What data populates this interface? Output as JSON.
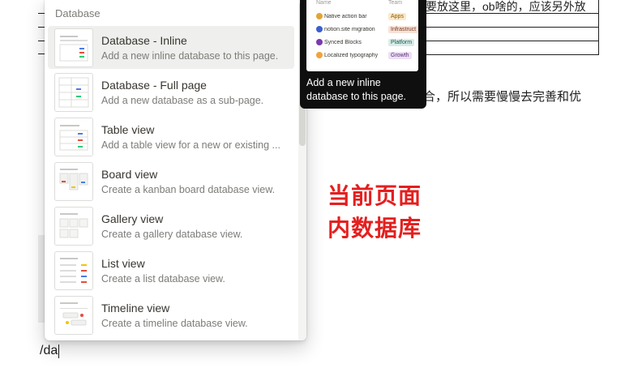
{
  "menu": {
    "section_label": "Database",
    "items": [
      {
        "title": "Database - Inline",
        "description": "Add a new inline database to this page."
      },
      {
        "title": "Database - Full page",
        "description": "Add a new database as a sub-page."
      },
      {
        "title": "Table view",
        "description": "Add a table view for a new or existing ..."
      },
      {
        "title": "Board view",
        "description": "Create a kanban board database view."
      },
      {
        "title": "Gallery view",
        "description": "Create a gallery database view."
      },
      {
        "title": "List view",
        "description": "Create a list database view."
      },
      {
        "title": "Timeline view",
        "description": "Create a timeline database view."
      }
    ]
  },
  "preview": {
    "header_name": "Name",
    "header_team": "Team",
    "rows": [
      {
        "name": "Native action bar",
        "team": "Apps",
        "tag_bg": "#fbe9c8",
        "tag_fg": "#8a5a00",
        "dot": "#e4a33a"
      },
      {
        "name": "notion.site migration",
        "team": "Infrastruct",
        "tag_bg": "#f6e2d8",
        "tag_fg": "#7a3a1d",
        "dot": "#3a5fcd"
      },
      {
        "name": "Synced Blocks",
        "team": "Platform",
        "tag_bg": "#d8ece8",
        "tag_fg": "#1d5a4e",
        "dot": "#7a3ab0"
      },
      {
        "name": "Localized typography",
        "team": "Growth",
        "tag_bg": "#ece0f3",
        "tag_fg": "#5a2a7a",
        "dot": "#f2a23a"
      }
    ],
    "caption": "Add a new inline database to this page."
  },
  "document": {
    "table_cell_text": "要放这里，ob啥的，应该另外放",
    "paragraph_text": "合，所以需要慢慢去完善和优",
    "slash_command": "/da"
  },
  "annotation": {
    "line1": "当前页面",
    "line2": "内数据库",
    "color": "#e41f1f"
  }
}
